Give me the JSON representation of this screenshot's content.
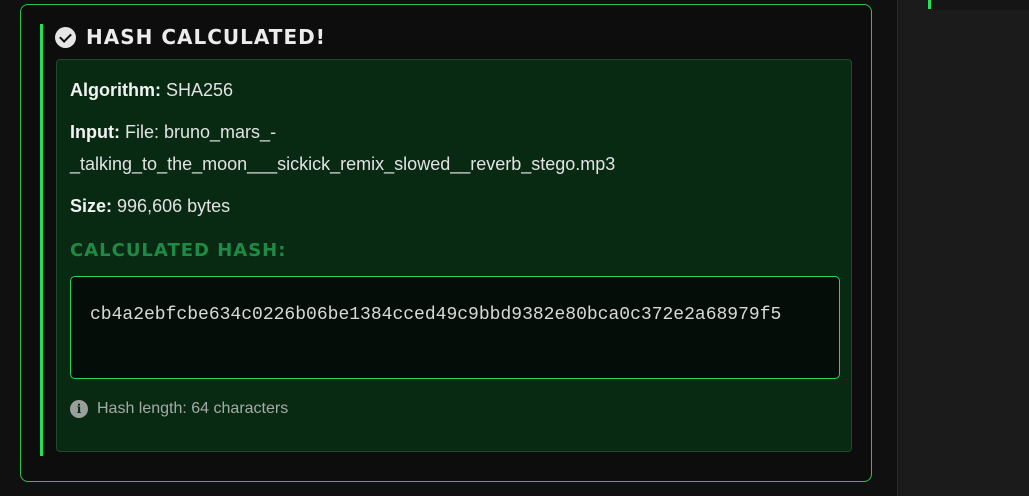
{
  "card": {
    "title": "HASH CALCULATED!",
    "icon": "check-circle-icon"
  },
  "details": {
    "algorithm_label": "Algorithm:",
    "algorithm_value": "SHA256",
    "input_label": "Input:",
    "input_value": "File: bruno_mars_-_talking_to_the_moon___sickick_remix_slowed__reverb_stego.mp3",
    "size_label": "Size:",
    "size_value": "996,606 bytes"
  },
  "hash": {
    "heading": "CALCULATED HASH:",
    "value": "cb4a2ebfcbe634c0226b06be1384cced49c9bbd9382e80bca0c372e2a68979f5",
    "length_icon": "info-icon",
    "length_text": "Hash length: 64 characters"
  },
  "colors": {
    "accent": "#22e05a",
    "panel_bg": "#082a12",
    "heading_green": "#1f8a45"
  }
}
